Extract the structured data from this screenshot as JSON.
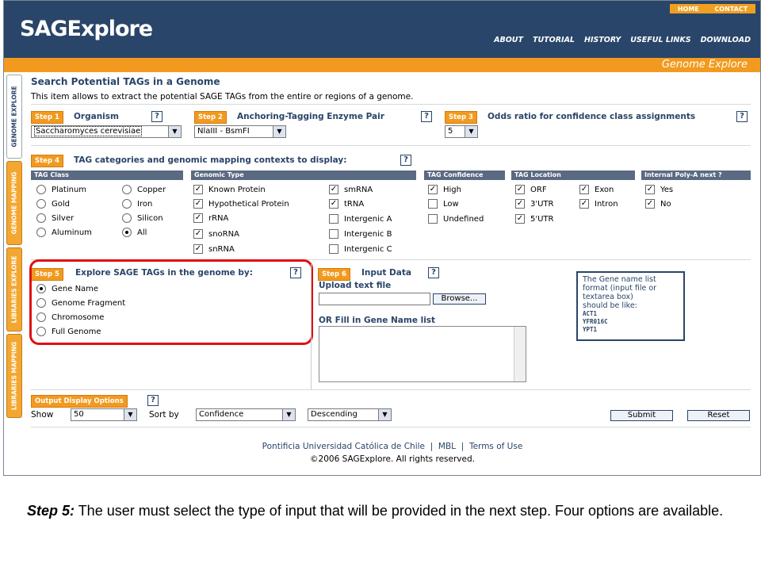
{
  "header": {
    "logo": "SAGExplore",
    "top_links": [
      "HOME",
      "CONTACT"
    ],
    "nav": [
      "ABOUT",
      "TUTORIAL",
      "HISTORY",
      "USEFUL LINKS",
      "DOWNLOAD"
    ],
    "section": "Genome Explore"
  },
  "tabs": [
    "GENOME EXPLORE",
    "GENOME MAPPING",
    "LIBRARIES EXPLORE",
    "LIBRARIES MAPPING"
  ],
  "page": {
    "title": "Search Potential TAGs in a Genome",
    "description": "This item allows to extract the potential SAGE TAGs from the entire or regions of a genome."
  },
  "step1": {
    "badge": "Step 1",
    "label": "Organism",
    "value": "Saccharomyces cerevisiae"
  },
  "step2": {
    "badge": "Step 2",
    "label": "Anchoring-Tagging Enzyme Pair",
    "value": "NlaIII - BsmFI"
  },
  "step3": {
    "badge": "Step 3",
    "label": "Odds ratio for confidence class assignments",
    "value": "5"
  },
  "step4": {
    "badge": "Step 4",
    "label": "TAG categories and genomic mapping contexts to display:",
    "tag_class": {
      "header": "TAG Class",
      "options": [
        "Platinum",
        "Gold",
        "Silver",
        "Aluminum",
        "Copper",
        "Iron",
        "Silicon",
        "All"
      ],
      "selected": "All"
    },
    "genomic_type": {
      "header": "Genomic Type",
      "options": [
        "Known Protein",
        "Hypothetical Protein",
        "rRNA",
        "snoRNA",
        "snRNA",
        "smRNA",
        "tRNA",
        "Intergenic A",
        "Intergenic B",
        "Intergenic C"
      ]
    },
    "tag_confidence": {
      "header": "TAG Confidence",
      "options": [
        "High",
        "Low",
        "Undefined"
      ]
    },
    "tag_location": {
      "header": "TAG Location",
      "options": [
        "ORF",
        "3'UTR",
        "5'UTR",
        "Exon",
        "Intron"
      ]
    },
    "polya": {
      "header": "Internal Poly-A next ?",
      "options": [
        "Yes",
        "No"
      ]
    },
    "checkbox_mark": "✓"
  },
  "step5": {
    "badge": "Step 5",
    "label": "Explore SAGE TAGs in the genome by:",
    "options": [
      "Gene Name",
      "Genome Fragment",
      "Chromosome",
      "Full Genome"
    ],
    "selected": "Gene Name"
  },
  "step6": {
    "badge": "Step 6",
    "label": "Input Data",
    "upload_label": "Upload text file",
    "browse": "Browse...",
    "fill_label": "OR Fill in Gene Name list",
    "tip_lines": [
      "The Gene name list",
      "format (input file or",
      "textarea box)",
      "should be like:"
    ],
    "tip_examples": [
      "ACT1",
      "YFR016C",
      "YPT1"
    ]
  },
  "output": {
    "badge": "Output Display Options",
    "show_label": "Show",
    "show_value": "50",
    "sort_label": "Sort by",
    "sort_value": "Confidence",
    "order_value": "Descending",
    "submit": "Submit",
    "reset": "Reset"
  },
  "footer": {
    "links": [
      "Pontificia Universidad Católica de Chile",
      "MBL",
      "Terms of Use"
    ],
    "sep": "|",
    "copyright": "©2006 SAGExplore. All rights reserved."
  },
  "caption": {
    "step": "Step 5:",
    "text": " The user must select the type of input that will be provided in the next step. Four options are available."
  },
  "colors": {
    "navy": "#294569",
    "orange": "#f29a1f",
    "red": "#e01010"
  }
}
